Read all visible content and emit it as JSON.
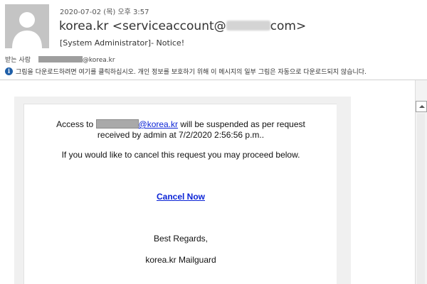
{
  "header": {
    "date": "2020-07-02 (목) 오후 3:57",
    "from_name": "korea.kr",
    "from_addr_start": "<serviceaccount@",
    "from_addr_end": "com>",
    "subject": "[System Administrator]- Notice!",
    "to_label": "받는 사람",
    "to_suffix": "@korea.kr",
    "info_text": "그림을 다운로드하려면 여기를 클릭하십시오. 개인 정보를 보호하기 위해 이 메시지의 일부 그림은 자동으로 다운로드되지 않습니다."
  },
  "message": {
    "access_prefix": "Access to ",
    "account_domain": "@korea.kr",
    "suspend_text": "  will be suspended as per request",
    "received_text": "received by admin  at 7/2/2020 2:56:56 p.m..",
    "cancel_prompt": "If you would like to cancel this request you may proceed below.",
    "cancel_link": "Cancel Now",
    "regards": "Best  Regards,",
    "signature": "korea.kr  Mailguard"
  },
  "colors": {
    "link": "#0b24d6",
    "info_icon": "#1f5fa8"
  },
  "icons": {
    "avatar": "person-silhouette-icon",
    "info": "info-icon",
    "scroll_up": "chevron-up-icon"
  }
}
